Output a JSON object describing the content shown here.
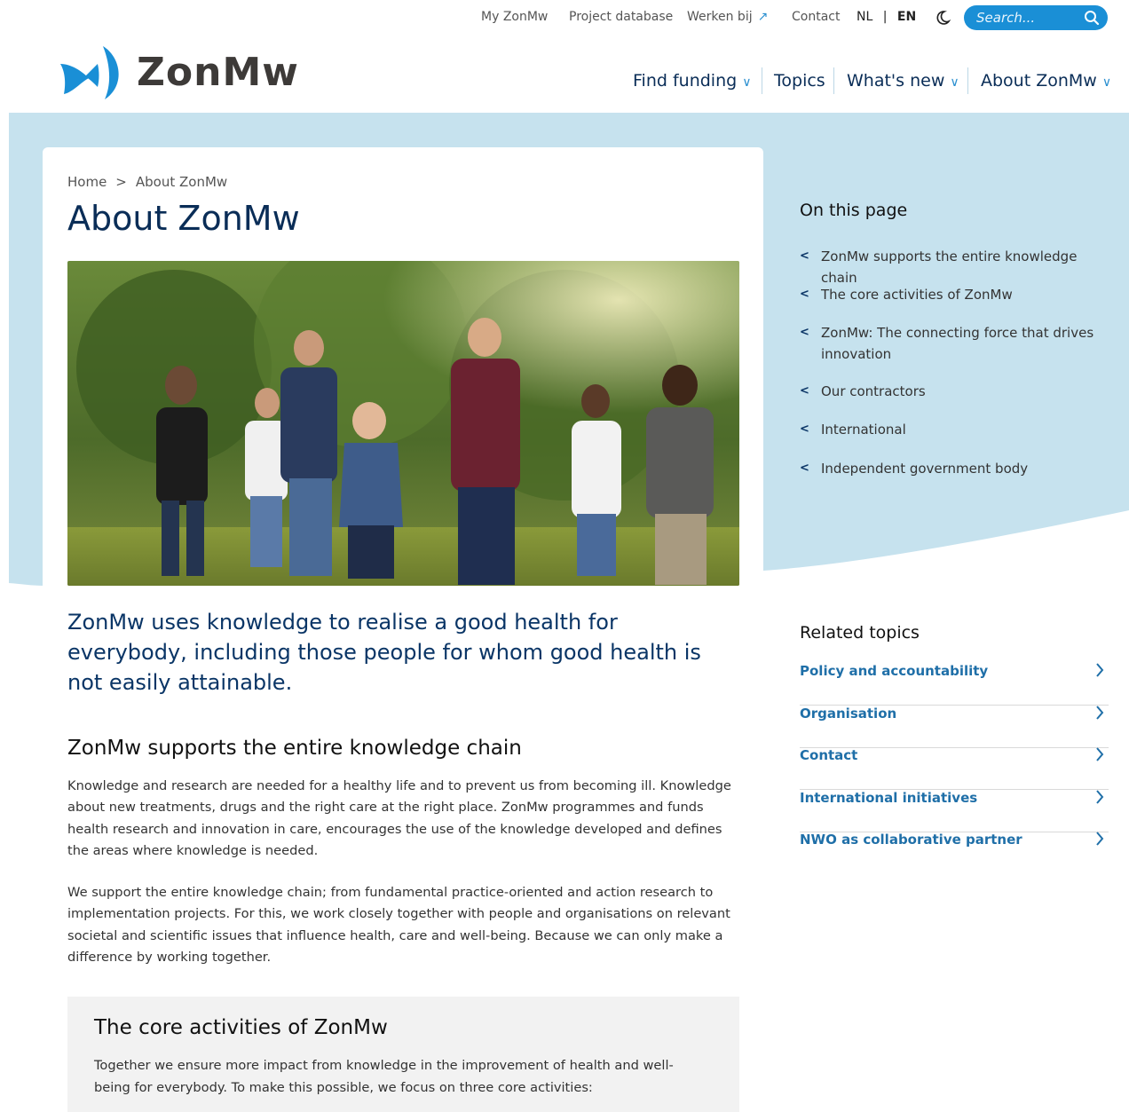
{
  "utility_nav": {
    "my_zonmw": "My ZonMw",
    "project_database": "Project database",
    "werken_bij": "Werken bij",
    "contact": "Contact",
    "lang_nl": "NL",
    "lang_sep": "|",
    "lang_en": "EN",
    "search_placeholder": "Search..."
  },
  "logo": {
    "text": "ZonMw"
  },
  "main_nav": {
    "find_funding": "Find funding",
    "topics": "Topics",
    "whats_new": "What's new",
    "about": "About ZonMw"
  },
  "breadcrumb": {
    "home": "Home",
    "sep": ">",
    "current": "About ZonMw"
  },
  "page": {
    "title": "About ZonMw",
    "lead": "ZonMw uses knowledge to realise a good health for everybody, including those people for whom good health is not easily attainable.",
    "section1": {
      "heading": "ZonMw supports the entire knowledge chain",
      "p1": "Knowledge and research are needed for a healthy life and to prevent us from becoming ill. Knowledge about new treatments, drugs and the right care at the right place. ZonMw programmes and funds health research and innovation in care, encourages the use of the knowledge developed and defines the areas where knowledge is needed.",
      "p2": "We support the entire knowledge chain; from fundamental practice-oriented and action research to implementation projects. For this, we work closely together with people and organisations on relevant societal and scientific issues that influence health, care and well-being. Because we can only make a difference by working together."
    },
    "section2": {
      "heading": "The core activities of ZonMw",
      "p1": "Together we ensure more impact from knowledge in the improvement of health and well-being for everybody. To make this possible, we focus on three core activities:"
    }
  },
  "on_this_page": {
    "title": "On this page",
    "items": [
      "ZonMw supports the entire knowledge chain",
      "The core activities of ZonMw",
      "ZonMw: The connecting force that drives innovation",
      "Our contractors",
      "International",
      "Independent government body"
    ]
  },
  "related_topics": {
    "title": "Related topics",
    "items": [
      "Policy and accountability",
      "Organisation",
      "Contact",
      "International initiatives",
      "NWO as collaborative partner"
    ]
  },
  "colors": {
    "navy": "#0a2d57",
    "accent": "#1a8fd6",
    "band": "#c6e2ee",
    "link": "#1f6fa8"
  }
}
